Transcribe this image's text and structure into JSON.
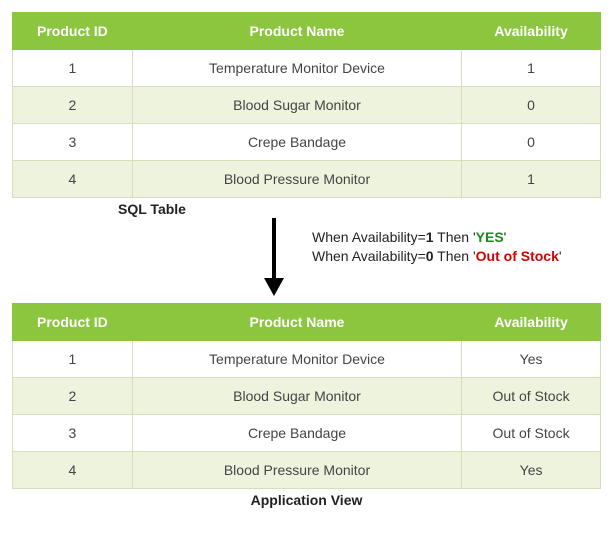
{
  "tables": {
    "top": {
      "caption": "SQL Table",
      "columns": [
        "Product ID",
        "Product Name",
        "Availability"
      ],
      "rows": [
        {
          "id": "1",
          "name": "Temperature Monitor Device",
          "avail": "1"
        },
        {
          "id": "2",
          "name": "Blood Sugar Monitor",
          "avail": "0"
        },
        {
          "id": "3",
          "name": "Crepe Bandage",
          "avail": "0"
        },
        {
          "id": "4",
          "name": "Blood Pressure Monitor",
          "avail": "1"
        }
      ]
    },
    "bottom": {
      "caption": "Application View",
      "columns": [
        "Product ID",
        "Product Name",
        "Availability"
      ],
      "rows": [
        {
          "id": "1",
          "name": "Temperature Monitor Device",
          "avail": "Yes"
        },
        {
          "id": "2",
          "name": "Blood Sugar Monitor",
          "avail": "Out of Stock"
        },
        {
          "id": "3",
          "name": "Crepe Bandage",
          "avail": "Out of Stock"
        },
        {
          "id": "4",
          "name": "Blood Pressure Monitor",
          "avail": "Yes"
        }
      ]
    }
  },
  "rules": {
    "line1_pre": "When Availability=",
    "line1_val": "1",
    "line1_then": " Then '",
    "line1_result": "YES",
    "line1_post": "'",
    "line2_pre": "When Availability=",
    "line2_val": "0",
    "line2_then": " Then '",
    "line2_result": "Out of Stock",
    "line2_post": "'"
  }
}
